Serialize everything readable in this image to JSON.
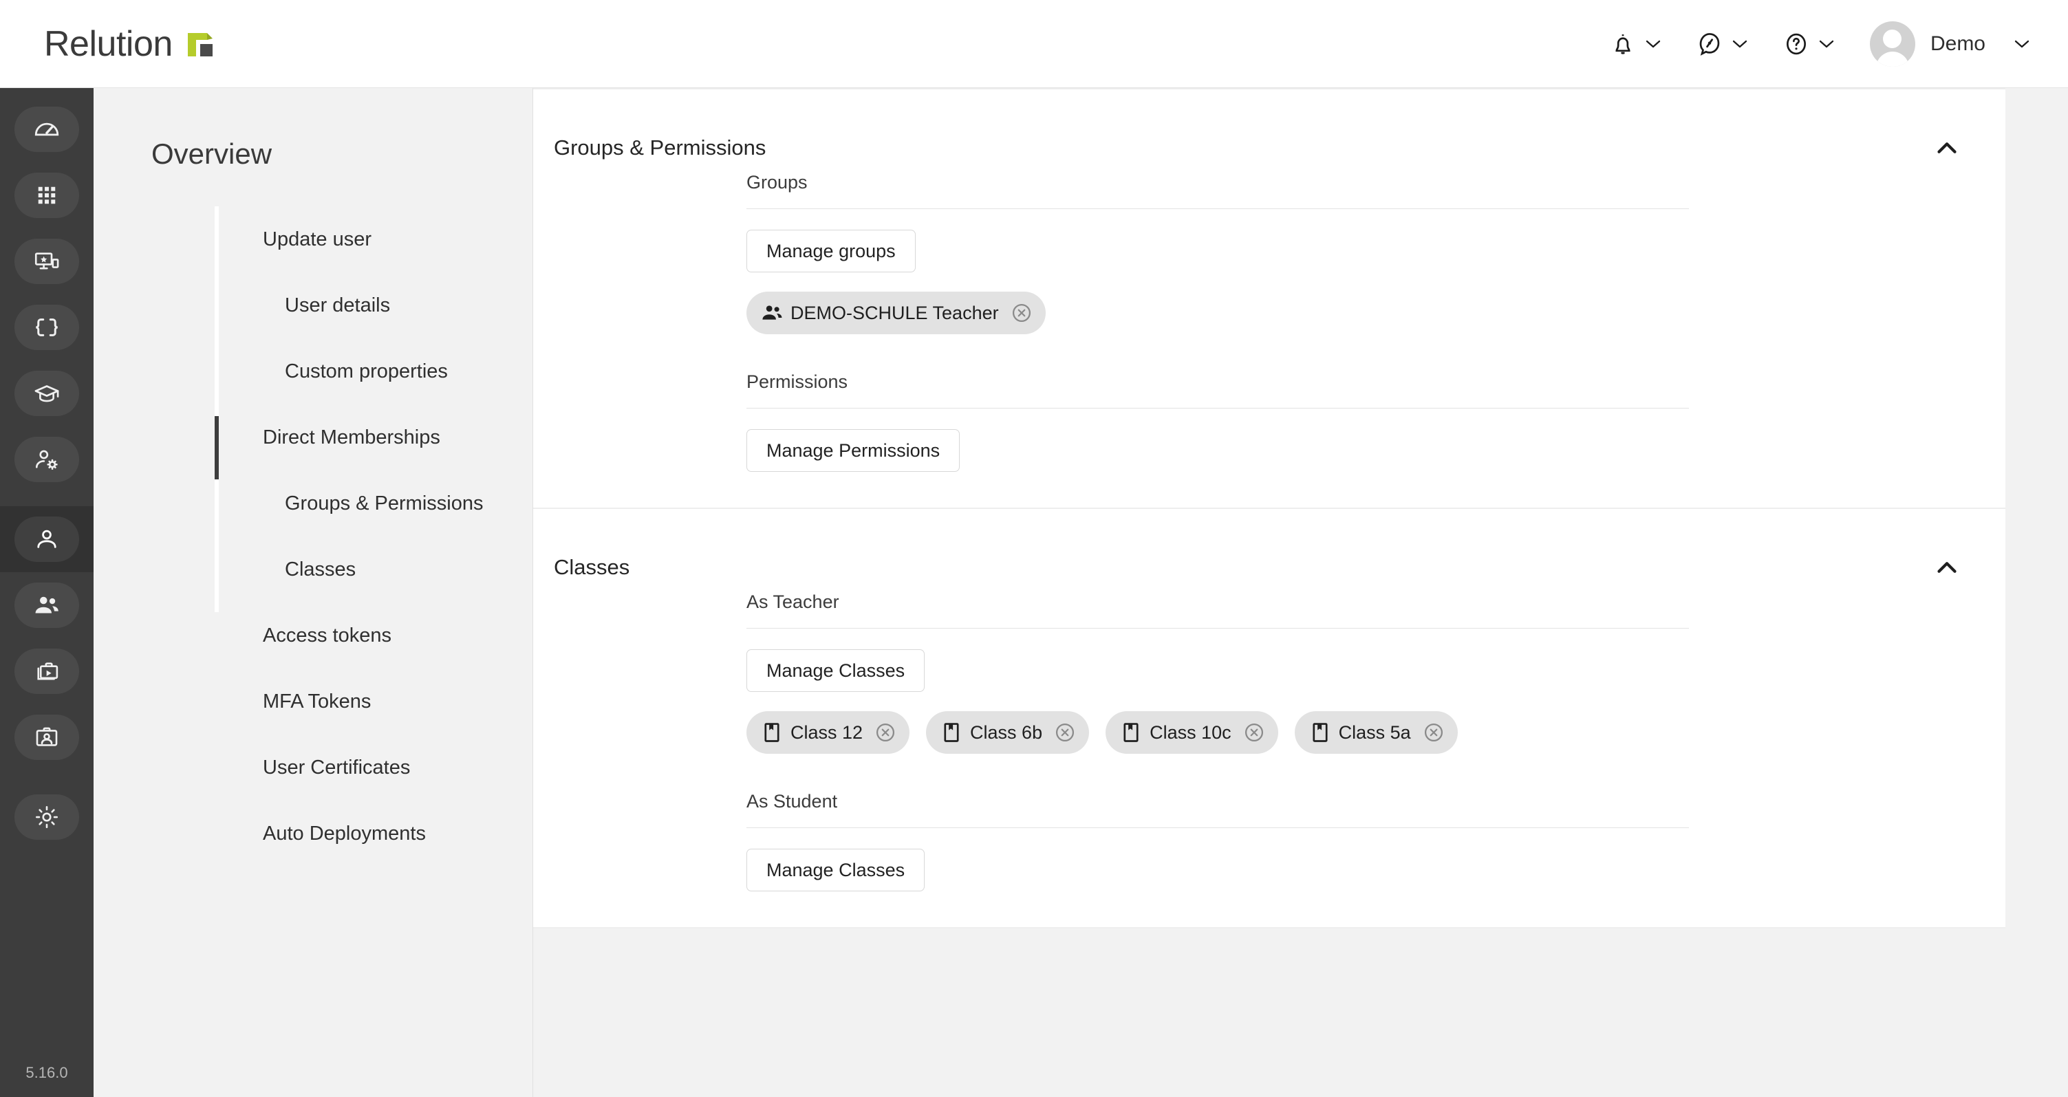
{
  "app": {
    "brand_name": "Relution",
    "version": "5.16.0",
    "accent_color": "#b5cc2b",
    "rail_bg": "#3d3d3d"
  },
  "header": {
    "notifications_icon": "bell-icon",
    "feedback_icon": "compass-icon",
    "help_icon": "help-circle-icon",
    "user_name": "Demo",
    "avatar_icon": "avatar-icon",
    "chevron_icon": "chevron-down-icon"
  },
  "rail": {
    "items": [
      {
        "icon": "dashboard-speedometer-icon",
        "active": false
      },
      {
        "icon": "apps-grid-icon",
        "active": false
      },
      {
        "icon": "device-star-icon",
        "active": false
      },
      {
        "icon": "code-brackets-icon",
        "active": false
      },
      {
        "icon": "graduation-cap-icon",
        "active": false
      },
      {
        "icon": "user-settings-icon",
        "active": false
      },
      {
        "icon": "person-icon",
        "active": true
      },
      {
        "icon": "people-group-icon",
        "active": false
      },
      {
        "icon": "media-briefcase-icon",
        "active": false
      },
      {
        "icon": "id-badge-icon",
        "active": false
      },
      {
        "icon": "gear-icon",
        "active": false
      }
    ]
  },
  "subnav": {
    "title": "Overview",
    "items": [
      {
        "label": "Update user",
        "level": 0,
        "active": false
      },
      {
        "label": "User details",
        "level": 1,
        "active": false
      },
      {
        "label": "Custom properties",
        "level": 1,
        "active": false
      },
      {
        "label": "Direct Memberships",
        "level": 0,
        "active": true
      },
      {
        "label": "Groups & Permissions",
        "level": 1,
        "active": false
      },
      {
        "label": "Classes",
        "level": 1,
        "active": false
      },
      {
        "label": "Access tokens",
        "level": 0,
        "active": false
      },
      {
        "label": "MFA Tokens",
        "level": 0,
        "active": false
      },
      {
        "label": "User Certificates",
        "level": 0,
        "active": false
      },
      {
        "label": "Auto Deployments",
        "level": 0,
        "active": false
      }
    ]
  },
  "sections": {
    "groups_permissions": {
      "title": "Groups & Permissions",
      "collapse_icon": "chevron-up-icon",
      "groups_label": "Groups",
      "manage_groups_button": "Manage groups",
      "group_chips": [
        {
          "label": "DEMO-SCHULE Teacher",
          "icon": "people-group-icon",
          "remove_icon": "close-circle-icon"
        }
      ],
      "permissions_label": "Permissions",
      "manage_permissions_button": "Manage Permissions"
    },
    "classes": {
      "title": "Classes",
      "collapse_icon": "chevron-up-icon",
      "as_teacher_label": "As Teacher",
      "teacher_manage_button": "Manage Classes",
      "teacher_chips": [
        {
          "label": "Class 12",
          "icon": "class-book-icon",
          "remove_icon": "close-circle-icon"
        },
        {
          "label": "Class 6b",
          "icon": "class-book-icon",
          "remove_icon": "close-circle-icon"
        },
        {
          "label": "Class 10c",
          "icon": "class-book-icon",
          "remove_icon": "close-circle-icon"
        },
        {
          "label": "Class 5a",
          "icon": "class-book-icon",
          "remove_icon": "close-circle-icon"
        }
      ],
      "as_student_label": "As Student",
      "student_manage_button": "Manage Classes",
      "student_chips": []
    }
  }
}
